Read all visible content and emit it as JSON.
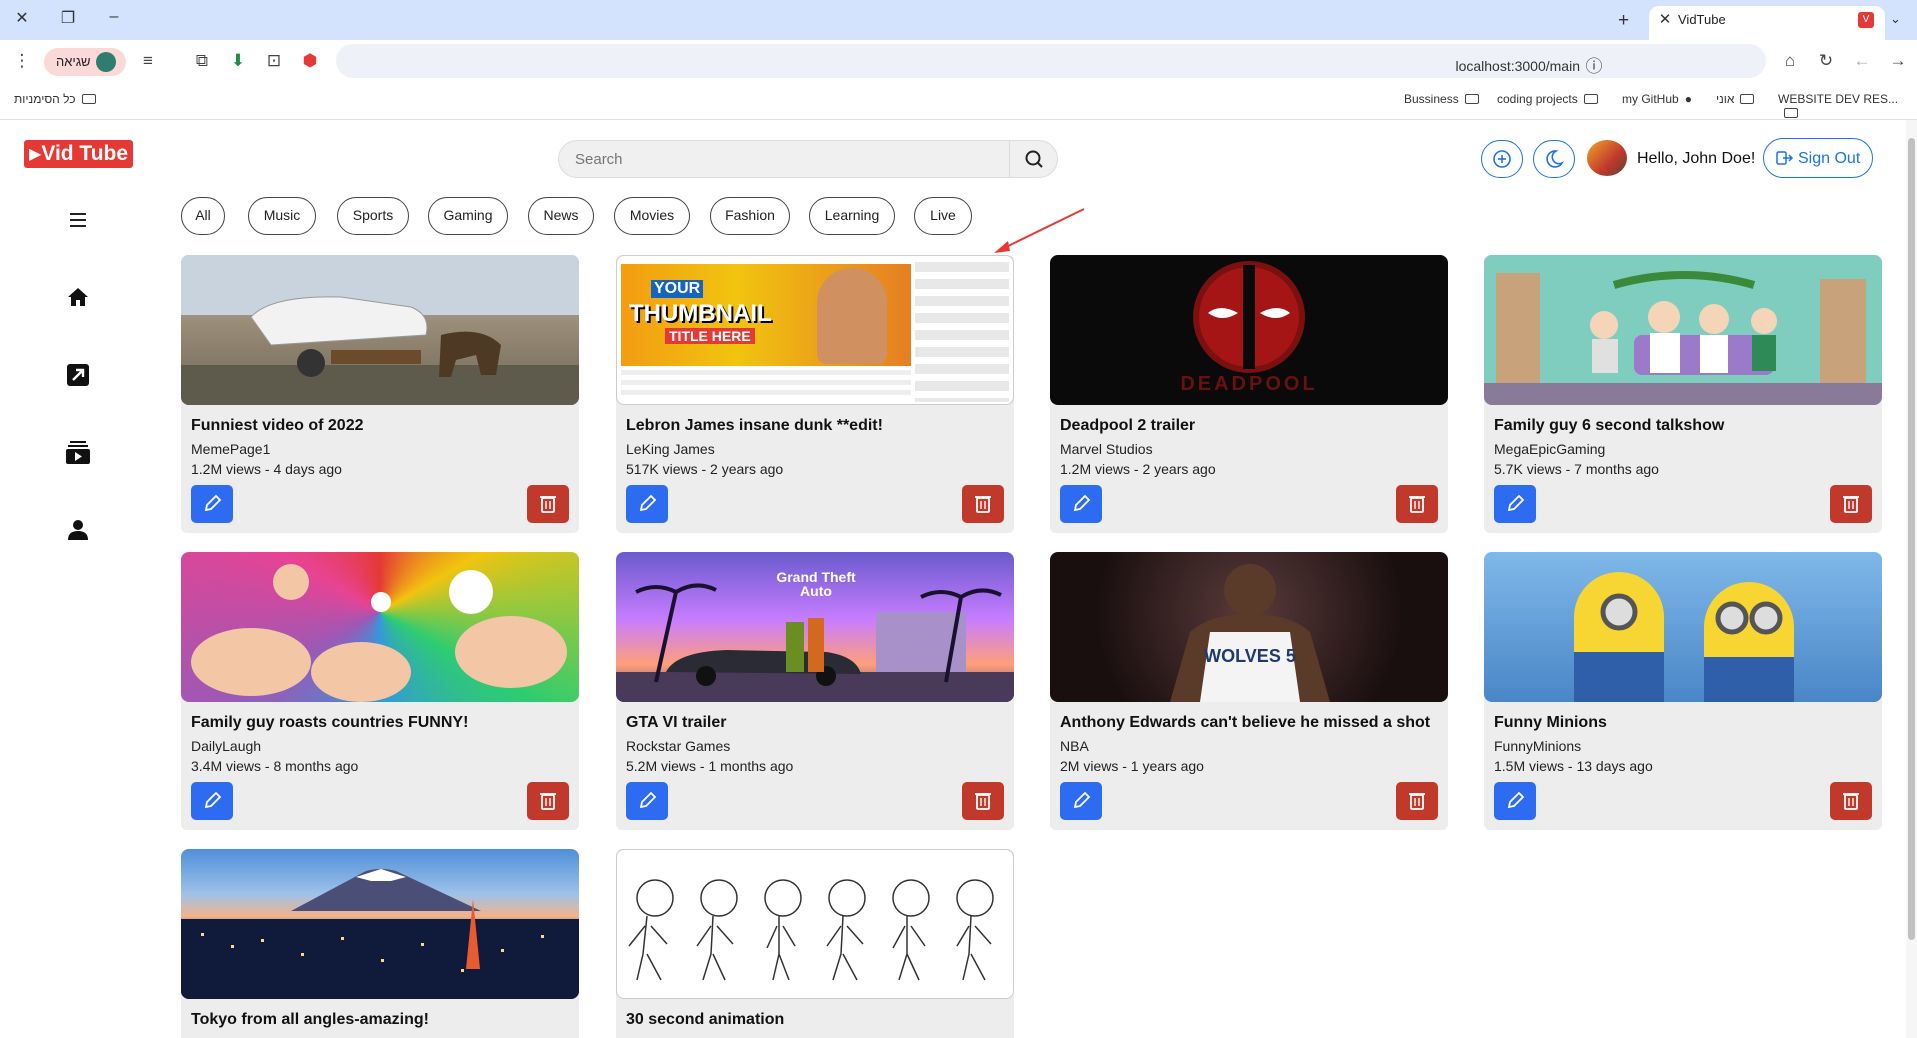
{
  "browser": {
    "tab_title": "VidTube",
    "tab_favicon": "V",
    "url": "localhost:3000/main",
    "error_chip": "שגיאה",
    "bookmarks": [
      "Bussiness",
      "coding projects",
      "my GitHub",
      "אוני",
      "WEBSITE DEV RES..."
    ],
    "all_bookmarks": "כל הסימניות"
  },
  "app": {
    "logo_text": "Vid Tube",
    "search_placeholder": "Search",
    "greeting": "Hello, John Doe!",
    "signout_label": "Sign Out",
    "accent_color": "#1a73e8",
    "brand_color": "#e53935"
  },
  "sidebar": {
    "items": [
      "menu-icon",
      "home-icon",
      "trending-icon",
      "subscriptions-icon",
      "profile-icon"
    ]
  },
  "categories": [
    "All",
    "Music",
    "Sports",
    "Gaming",
    "News",
    "Movies",
    "Fashion",
    "Learning",
    "Live"
  ],
  "videos": [
    {
      "title": "Funniest video of 2022",
      "channel": "MemePage1",
      "meta": "1.2M views - 4 days ago"
    },
    {
      "title": "Lebron James insane dunk **edit!",
      "channel": "LeKing James",
      "meta": "517K views - 2 years ago",
      "thumb_text_1": "YOUR",
      "thumb_text_2": "THUMBNAIL",
      "thumb_text_3": "TITLE HERE"
    },
    {
      "title": "Deadpool 2 trailer",
      "channel": "Marvel Studios",
      "meta": "1.2M views - 2 years ago",
      "thumb_text": "DEADPOOL"
    },
    {
      "title": "Family guy 6 second talkshow",
      "channel": "MegaEpicGaming",
      "meta": "5.7K views - 7 months ago"
    },
    {
      "title": "Family guy roasts countries FUNNY!",
      "channel": "DailyLaugh",
      "meta": "3.4M views - 8 months ago"
    },
    {
      "title": "GTA VI trailer",
      "channel": "Rockstar Games",
      "meta": "5.2M views - 1 months ago",
      "thumb_text": "Grand Theft Auto"
    },
    {
      "title": "Anthony Edwards can't believe he missed a shot",
      "channel": "NBA",
      "meta": "2M views - 1 years ago",
      "thumb_text": "WOLVES 5"
    },
    {
      "title": "Funny Minions",
      "channel": "FunnyMinions",
      "meta": "1.5M views - 13 days ago"
    },
    {
      "title": "Tokyo from all angles-amazing!",
      "channel": "",
      "meta": ""
    },
    {
      "title": "30 second animation",
      "channel": "",
      "meta": ""
    }
  ]
}
